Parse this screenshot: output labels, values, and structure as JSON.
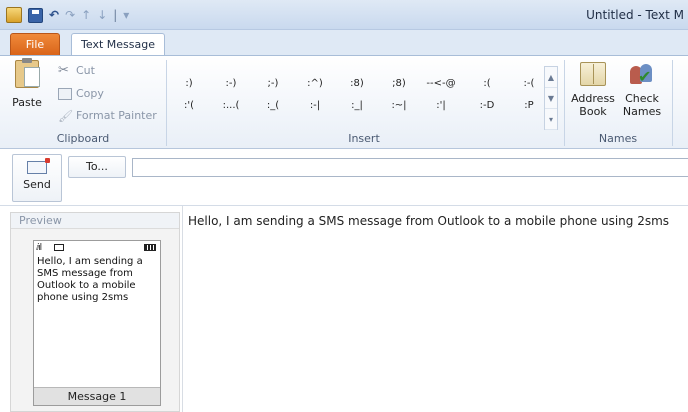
{
  "window": {
    "title": "Untitled - Text M"
  },
  "quick_access": {
    "separator": "|"
  },
  "tabs": {
    "file": "File",
    "text_message": "Text Message"
  },
  "ribbon": {
    "clipboard": {
      "paste": "Paste",
      "cut": "Cut",
      "copy": "Copy",
      "format_painter": "Format Painter",
      "group_label": "Clipboard"
    },
    "insert": {
      "group_label": "Insert",
      "row1": [
        ":)",
        ":-)",
        ";-)",
        ":^)",
        ":8)",
        ";8)",
        "--<-@",
        ":(",
        ":-("
      ],
      "row2": [
        ":'(",
        ":...(",
        ":_(",
        ":-|",
        ":_|",
        ":~|",
        ":'|",
        ":-D",
        ":P"
      ]
    },
    "names": {
      "address_book": [
        "Address",
        "Book"
      ],
      "check_names": [
        "Check",
        "Names"
      ],
      "group_label": "Names"
    }
  },
  "compose": {
    "send": "Send",
    "to_button": "To...",
    "to_value": ""
  },
  "preview": {
    "header": "Preview",
    "phone_text": "Hello, I am sending a SMS message from Outlook to a mobile phone using 2sms",
    "footer": "Message 1"
  },
  "message": {
    "body": "Hello, I am sending a SMS message from Outlook to a mobile phone using 2sms"
  }
}
